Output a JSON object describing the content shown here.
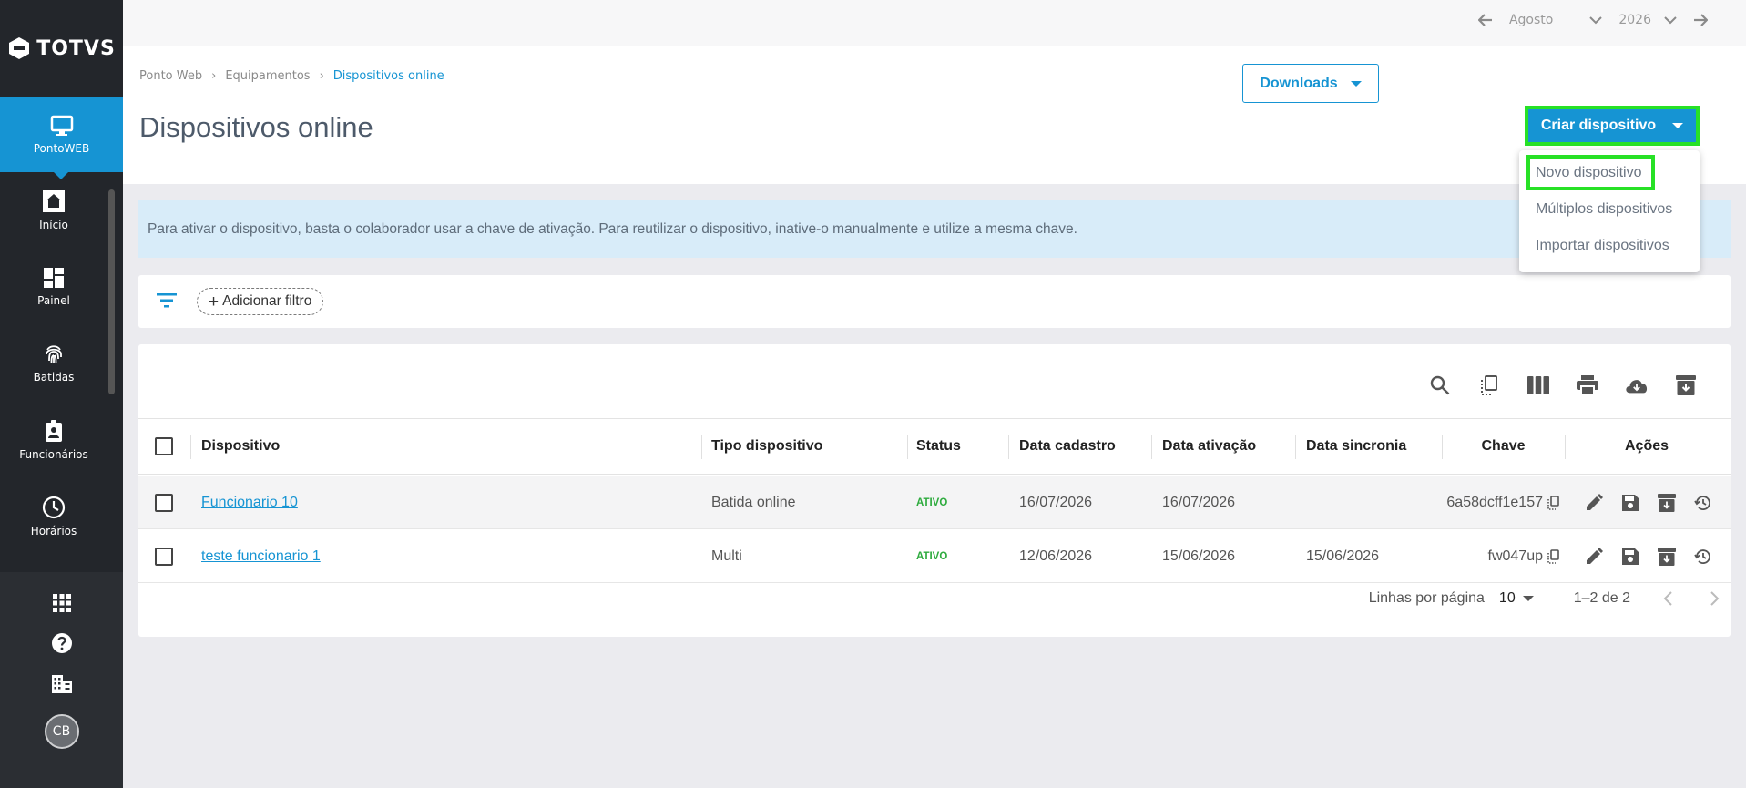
{
  "brand": {
    "name": "TOTVS"
  },
  "sidebar": {
    "active": {
      "label": "PontoWEB",
      "icon": "monitor-icon"
    },
    "items": [
      {
        "label": "Início",
        "icon": "home-icon"
      },
      {
        "label": "Painel",
        "icon": "dashboard-icon"
      },
      {
        "label": "Batidas",
        "icon": "fingerprint-icon"
      },
      {
        "label": "Funcionários",
        "icon": "badge-icon"
      },
      {
        "label": "Horários",
        "icon": "clock-icon"
      }
    ],
    "bottom": {
      "apps_icon": "apps-icon",
      "help_icon": "help-icon",
      "company_icon": "building-icon",
      "avatar_initials": "CB"
    }
  },
  "period": {
    "month": "Agosto",
    "year": "2026"
  },
  "breadcrumb": [
    "Ponto Web",
    "Equipamentos",
    "Dispositivos online"
  ],
  "page_title": "Dispositivos online",
  "buttons": {
    "downloads": "Downloads",
    "create": "Criar dispositivo"
  },
  "dropdown": [
    "Novo dispositivo",
    "Múltiplos dispositivos",
    "Importar dispositivos"
  ],
  "banner": "Para ativar o dispositivo, basta o colaborador usar a chave de ativação. Para reutilizar o dispositivo, inative-o manualmente e utilize a mesma chave.",
  "filter": {
    "add_label": "Adicionar filtro"
  },
  "table": {
    "columns": [
      "Dispositivo",
      "Tipo dispositivo",
      "Status",
      "Data cadastro",
      "Data ativação",
      "Data sincronia",
      "Chave",
      "Ações"
    ],
    "rows": [
      {
        "device": "Funcionario 10",
        "type": "Batida online",
        "status": "ATIVO",
        "registered": "16/07/2026",
        "activated": "16/07/2026",
        "synced": "",
        "key": "6a58dcff1e157"
      },
      {
        "device": "teste funcionario 1",
        "type": "Multi",
        "status": "ATIVO",
        "registered": "12/06/2026",
        "activated": "15/06/2026",
        "synced": "15/06/2026",
        "key": "fw047up"
      }
    ]
  },
  "pagination": {
    "rows_label": "Linhas por página",
    "rows_value": "10",
    "range": "1–2 de 2"
  },
  "colors": {
    "accent": "#1694d3",
    "sidebar": "#23262b",
    "highlight": "#27e126",
    "status_active": "#2eab3e"
  }
}
